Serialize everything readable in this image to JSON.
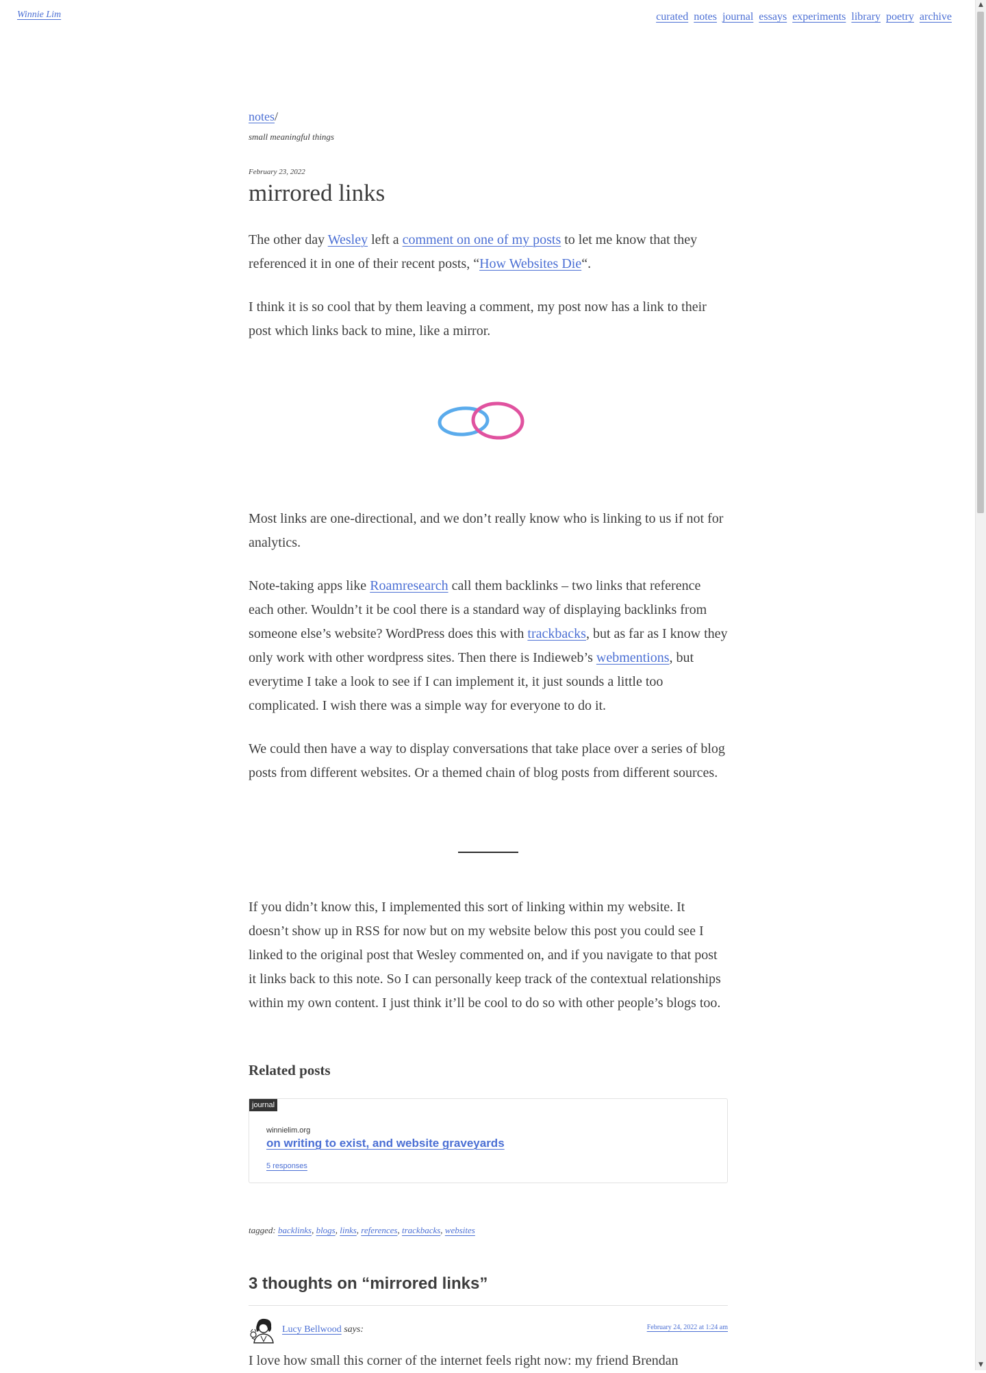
{
  "site": {
    "title": "Winnie Lim"
  },
  "nav": [
    "curated",
    "notes",
    "journal",
    "essays",
    "experiments",
    "library",
    "poetry",
    "archive"
  ],
  "section": {
    "name": "notes",
    "slash": "/",
    "tagline": "small meaningful things"
  },
  "post": {
    "date": "February 23, 2022",
    "title": "mirrored links",
    "p1": {
      "t1": "The other day ",
      "l1": "Wesley",
      "t2": " left a ",
      "l2": "comment on one of my posts",
      "t3": " to let me know that they referenced it in one of their recent posts, “",
      "l3": "How Websites Die",
      "t4": "“."
    },
    "p2": "I think it is so cool that by them leaving a comment, my post now has a link to their post which links back to mine, like a mirror.",
    "p3": "Most links are one-directional, and we don’t really know who is linking to us if not for analytics.",
    "p4": {
      "t1": "Note-taking apps like ",
      "l1": "Roamresearch",
      "t2": " call them backlinks – two links that reference each other. Wouldn’t it be cool there is a standard way of displaying backlinks from someone else’s website? WordPress does this with ",
      "l2": "trackbacks",
      "t3": ", but as far as I know they only work with other wordpress sites. Then there is Indieweb’s ",
      "l3": "webmentions",
      "t4": ", but everytime I take a look to see if I can implement it, it just sounds a little too complicated. I wish there was a simple way for everyone to do it."
    },
    "p5": "We could then have a way to display conversations that take place over a series of blog posts from different websites. Or a themed chain of blog posts from different sources.",
    "p6": "If you didn’t know this, I implemented this sort of linking within my website. It doesn’t show up in RSS for now but on my website below this post you could see I linked to the original post that Wesley commented on, and if you navigate to that post it links back to this note. So I can personally keep track of the contextual relationships within my own content. I just think it’ll be cool to do so with other people’s blogs too."
  },
  "colors": {
    "link": "#4b6fd4",
    "ring_blue": "#5aabec",
    "ring_pink": "#e0529f"
  },
  "related": {
    "heading": "Related posts",
    "badge": "journal",
    "domain": "winnielim.org",
    "title": "on writing to exist, and website graveyards",
    "responses": "5 responses"
  },
  "tags": {
    "label": "tagged:",
    "items": [
      "backlinks",
      "blogs",
      "links",
      "references",
      "trackbacks",
      "websites"
    ]
  },
  "comments": {
    "heading": "3 thoughts on “mirrored links”",
    "first": {
      "author": "Lucy Bellwood",
      "says": "says:",
      "date": "February 24, 2022 at 1:24 am",
      "text": "I love how small this corner of the internet feels right now: my friend Brendan"
    }
  }
}
